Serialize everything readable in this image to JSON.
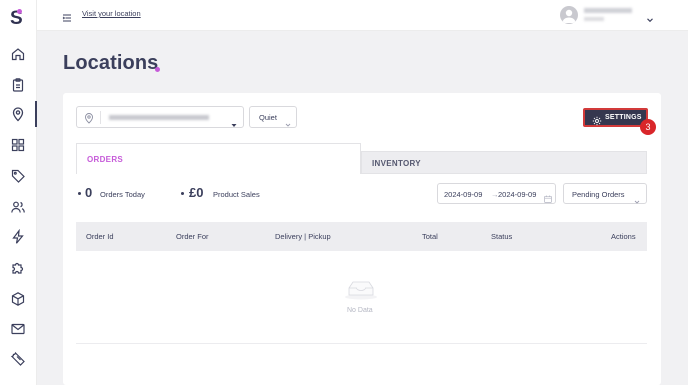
{
  "topbar": {
    "visit_link": "Visit your location"
  },
  "page": {
    "title": "Locations"
  },
  "filters": {
    "quiet_label": "Quiet",
    "settings_label": "SETTINGS",
    "step_badge": "3"
  },
  "tabs": [
    {
      "label": "ORDERS",
      "active": true
    },
    {
      "label": "INVENTORY",
      "active": false
    }
  ],
  "stats": [
    {
      "value": "0",
      "label": "Orders Today"
    },
    {
      "value": "£0",
      "label": "Product Sales"
    }
  ],
  "date_range": {
    "start": "2024-09-09",
    "separator": "→",
    "end": "2024-09-09"
  },
  "order_status_filter": "Pending Orders",
  "table": {
    "columns": [
      "Order Id",
      "Order For",
      "Delivery | Pickup",
      "Total",
      "Status",
      "Actions"
    ],
    "empty_text": "No Data"
  },
  "colors": {
    "accent": "#c65bd9",
    "dark": "#35374f",
    "badge": "#d9262a"
  },
  "icons": [
    "home-icon",
    "clipboard-icon",
    "location-pin-icon",
    "grid-icon",
    "tag-icon",
    "users-icon",
    "lightning-icon",
    "puzzle-icon",
    "box-icon",
    "mail-icon",
    "ticket-icon",
    "gear-icon",
    "calendar-icon",
    "empty-inbox-icon"
  ]
}
